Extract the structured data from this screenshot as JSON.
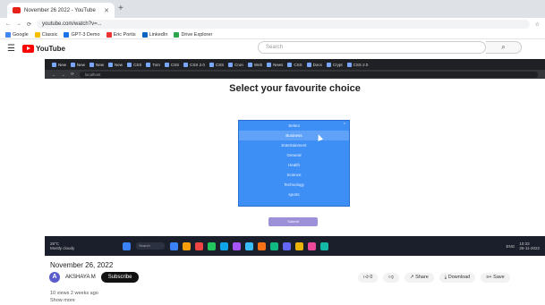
{
  "browser": {
    "tab_title": "November 26 2022 - YouTube",
    "url": "youtube.com/watch?v=...",
    "bookmarks": [
      "Google",
      "Classic",
      "GPT-3 Demo",
      "Eric Portis",
      "LinkedIn",
      "Drive Explorer"
    ],
    "bookmark_colors": [
      "#4285f4",
      "#fbbc05",
      "#1a73e8",
      "#e33",
      "#0a66c2",
      "#2da44e"
    ]
  },
  "youtube": {
    "logo_text": "YouTube",
    "search_placeholder": "Search"
  },
  "video": {
    "inner_tabs": [
      "New",
      "New",
      "New",
      "New",
      "CSS",
      "Tom",
      "CSS",
      "CSS 2.0",
      "CSS",
      "Cron",
      "Web",
      "News",
      "CSS",
      "Docs",
      "Crypt",
      "CSS 2.0"
    ],
    "inner_url": "localhost",
    "heading": "Select your favourite choice",
    "dropdown_items": [
      "Select",
      "Business",
      "Entertainment",
      "General",
      "Health",
      "Science",
      "Technology",
      "sports"
    ],
    "selected_index": 1,
    "submit_label": "Submit",
    "taskbar": {
      "weather_temp": "28°C",
      "weather_desc": "Mostly cloudy",
      "search_label": "Search",
      "lang": "ENG",
      "time": "10:33",
      "date": "26-11-2022"
    },
    "taskbar_colors": [
      "#3b82f6",
      "#f59e0b",
      "#ef4444",
      "#22c55e",
      "#0ea5e9",
      "#a855f7",
      "#38bdf8",
      "#f97316",
      "#10b981",
      "#6366f1",
      "#eab308",
      "#ec4899",
      "#14b8a6"
    ]
  },
  "meta": {
    "date_title": "November 26, 2022",
    "avatar_letter": "A",
    "channel_name": "AKSHAYA M",
    "subscribe_label": "Subscribe",
    "likes": "0",
    "share_label": "Share",
    "download_label": "Download",
    "save_label": "Save",
    "views": "10 views  2 weeks ago",
    "show_more": "Show more"
  }
}
